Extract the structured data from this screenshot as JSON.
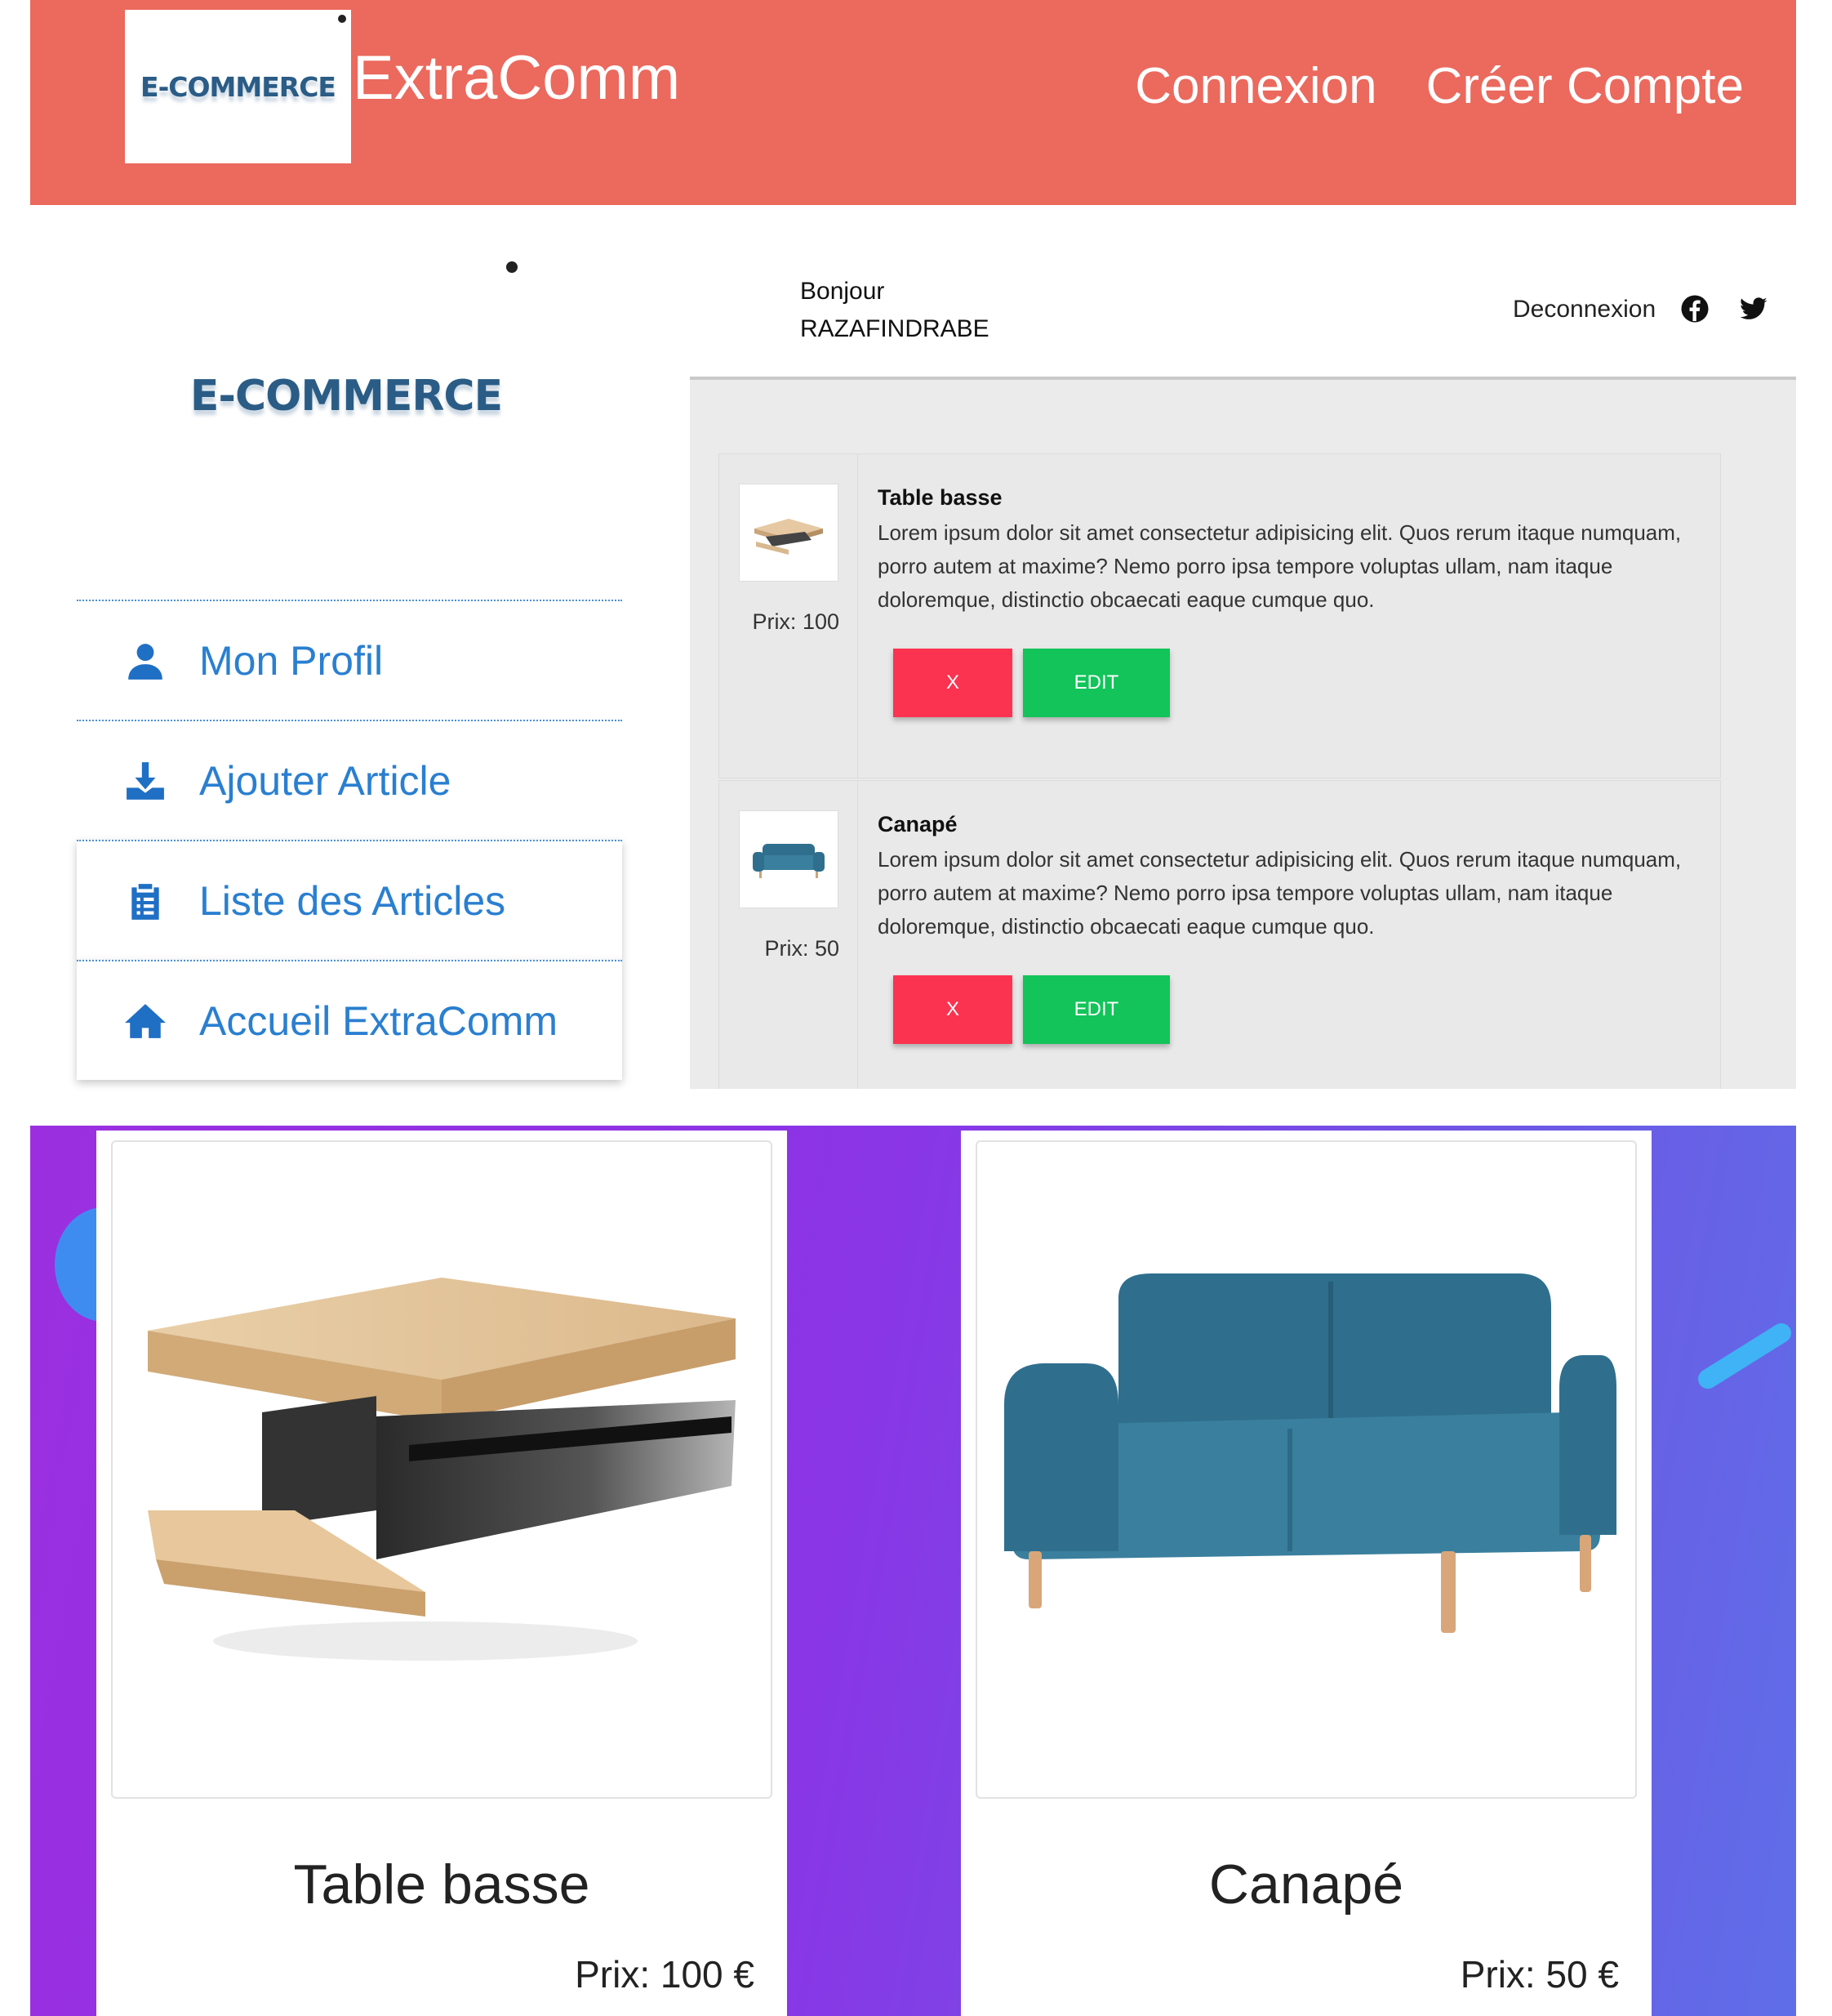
{
  "header": {
    "logo_text": "E-COMMERCE",
    "brand": "ExtraComm",
    "nav": [
      "Connexion",
      "Créer Compte"
    ],
    "color": "#eb695d"
  },
  "sidebar": {
    "logo_text": "E-COMMERCE",
    "items": [
      {
        "label": "Mon Profil",
        "icon": "user-icon"
      },
      {
        "label": "Ajouter Article",
        "icon": "download-icon"
      },
      {
        "label": "Liste des Articles",
        "icon": "clipboard-list-icon"
      },
      {
        "label": "Accueil ExtraComm",
        "icon": "home-icon"
      }
    ]
  },
  "userbar": {
    "greeting": "Bonjour",
    "username": "RAZAFINDRABE",
    "logout": "Deconnexion",
    "social": [
      "facebook-icon",
      "twitter-icon"
    ]
  },
  "articles": [
    {
      "title": "Table basse",
      "description": "Lorem ipsum dolor sit amet consectetur adipisicing elit. Quos rerum itaque numquam, porro autem at maxime? Nemo porro ipsa tempore voluptas ullam, nam itaque doloremque, distinctio obcaecati eaque cumque quo.",
      "price": "Prix: 100",
      "delete_label": "X",
      "edit_label": "EDIT"
    },
    {
      "title": "Canapé",
      "description": "Lorem ipsum dolor sit amet consectetur adipisicing elit. Quos rerum itaque numquam, porro autem at maxime? Nemo porro ipsa tempore voluptas ullam, nam itaque doloremque, distinctio obcaecati eaque cumque quo.",
      "price": "Prix: 50",
      "delete_label": "X",
      "edit_label": "EDIT"
    }
  ],
  "showcase": [
    {
      "name": "Table basse",
      "price": "Prix: 100 €"
    },
    {
      "name": "Canapé",
      "price": "Prix: 50 €"
    }
  ],
  "colors": {
    "delete": "#fb3350",
    "edit": "#12c459",
    "link": "#2a7fd0"
  }
}
